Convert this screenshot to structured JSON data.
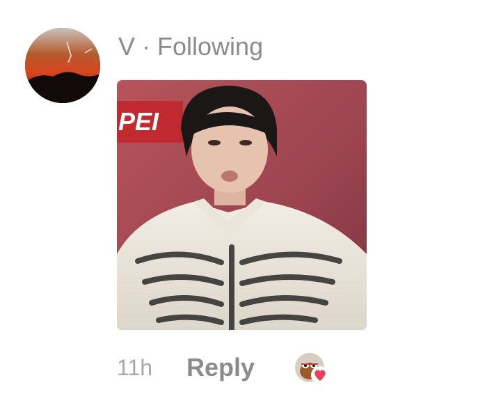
{
  "comment": {
    "author": "V",
    "separator": "·",
    "relationship": "Following",
    "photo_sign_text": "PEI"
  },
  "footer": {
    "time": "11h",
    "reply_label": "Reply"
  },
  "reaction": {
    "icon": "heart-icon",
    "color": "#e8425b"
  }
}
